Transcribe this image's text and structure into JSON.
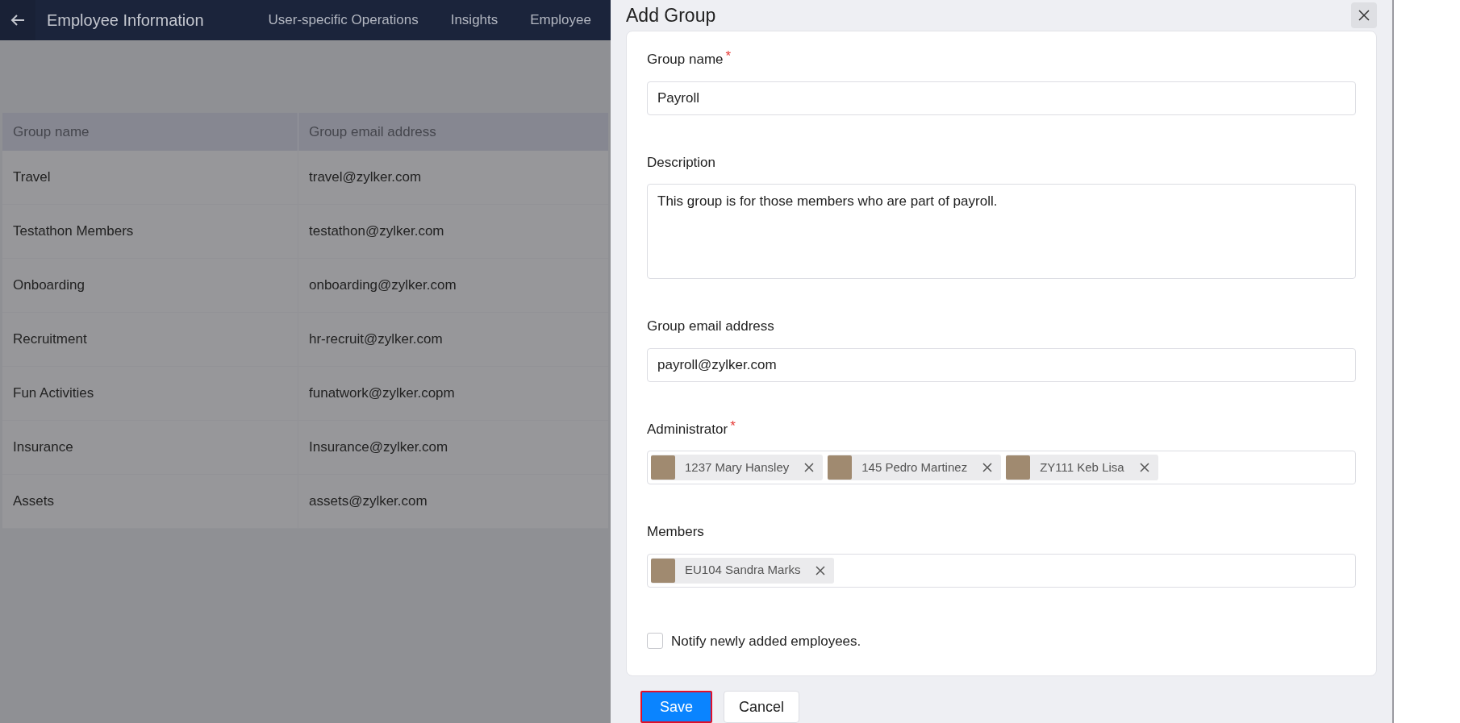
{
  "header": {
    "title": "Employee Information",
    "tabs": [
      {
        "label": "User-specific Operations",
        "selected": false
      },
      {
        "label": "Insights",
        "selected": false
      },
      {
        "label": "Employee",
        "selected": false
      }
    ]
  },
  "table": {
    "columns": [
      "Group name",
      "Group email address"
    ],
    "rows": [
      [
        "Travel",
        "travel@zylker.com"
      ],
      [
        "Testathon Members",
        "testathon@zylker.com"
      ],
      [
        "Onboarding",
        "onboarding@zylker.com"
      ],
      [
        "Recruitment",
        "hr-recruit@zylker.com"
      ],
      [
        "Fun Activities",
        "funatwork@zylker.copm"
      ],
      [
        "Insurance",
        "Insurance@zylker.com"
      ],
      [
        "Assets",
        "assets@zylker.com"
      ]
    ]
  },
  "dialog": {
    "title": "Add Group",
    "fields": [
      {
        "kind": "text",
        "label": "Group name",
        "required_mark": "*",
        "value": "Payroll"
      },
      {
        "kind": "textarea",
        "label": "Description",
        "value": "This group is for those members who are part of payroll."
      },
      {
        "kind": "text",
        "label": "Group email address",
        "value": "payroll@zylker.com"
      },
      {
        "kind": "chips",
        "label": "Administrator",
        "required_mark": "*",
        "chips": [
          "1237 Mary Hansley",
          "145 Pedro Martinez",
          "ZY111 Keb Lisa"
        ]
      },
      {
        "kind": "chips",
        "label": "Members",
        "chips": [
          "EU104 Sandra Marks"
        ]
      }
    ],
    "notify": {
      "label": "Notify newly added employees.",
      "checked": false
    },
    "buttons": [
      {
        "kind": "primary",
        "label": "Save"
      },
      {
        "kind": "secondary",
        "label": "Cancel"
      }
    ]
  }
}
